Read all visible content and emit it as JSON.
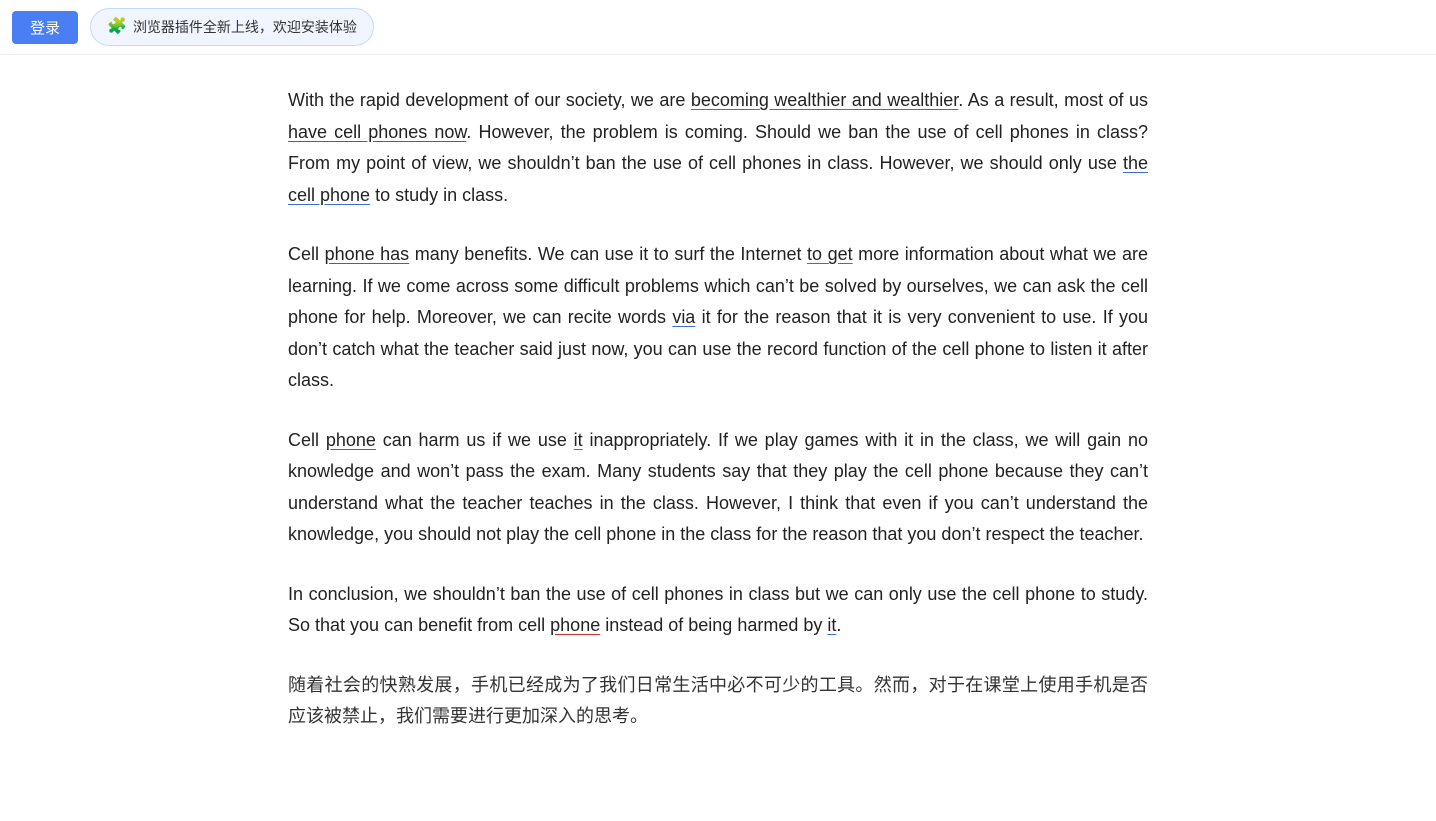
{
  "topbar": {
    "login_label": "登录",
    "plugin_text": "浏览器插件全新上线，欢迎安装体验"
  },
  "paragraphs": [
    {
      "id": "para1",
      "segments": [
        {
          "text": "With the rapid development of our society, we are ",
          "style": "normal"
        },
        {
          "text": "becoming wealthier and wealthier",
          "style": "underline-blue"
        },
        {
          "text": ". As a result, most of us ",
          "style": "normal"
        },
        {
          "text": "have cell phones now",
          "style": "underline-red"
        },
        {
          "text": ". However, the problem is coming. Should we ban the use of cell phones in class? From my point of view, we shouldn’t ban the use of cell phones in class. However, we should only use ",
          "style": "normal"
        },
        {
          "text": "the cell phone",
          "style": "underline-blue"
        },
        {
          "text": " to study in class.",
          "style": "normal"
        }
      ]
    },
    {
      "id": "para2",
      "segments": [
        {
          "text": "Cell ",
          "style": "normal"
        },
        {
          "text": "phone has",
          "style": "underline-red"
        },
        {
          "text": " many benefits. We can use it to surf the Internet ",
          "style": "normal"
        },
        {
          "text": "to get",
          "style": "underline-blue"
        },
        {
          "text": " more information about what we are learning. If we come across some difficult problems which can’t be solved by ourselves, we can ask the cell phone for help. Moreover, we can recite words ",
          "style": "normal"
        },
        {
          "text": "via",
          "style": "underline-blue"
        },
        {
          "text": " it for the reason that it is very convenient to use. If you don’t catch what the teacher said just now, you can use the record function of the cell phone to listen it after class.",
          "style": "normal"
        }
      ]
    },
    {
      "id": "para3",
      "segments": [
        {
          "text": "Cell ",
          "style": "normal"
        },
        {
          "text": "phone",
          "style": "underline-red"
        },
        {
          "text": " can harm us if we use ",
          "style": "normal"
        },
        {
          "text": "it",
          "style": "underline-blue"
        },
        {
          "text": " inappropriately. If we play games with it in the class, we will gain no knowledge and won’t pass the exam. Many students say that they play the cell phone because they can’t understand what the teacher teaches in the class. However, I think that even if you can’t understand the knowledge, you should not play the cell phone in the class for the reason that you don’t respect the teacher.",
          "style": "normal"
        }
      ]
    },
    {
      "id": "para4",
      "segments": [
        {
          "text": "In conclusion, we shouldn’t ban the use of cell phones in class but we can only use the cell phone to study. So that you can benefit from cell ",
          "style": "normal"
        },
        {
          "text": "phone",
          "style": "underline-red"
        },
        {
          "text": " instead of being harmed by ",
          "style": "normal"
        },
        {
          "text": "it",
          "style": "underline-blue"
        },
        {
          "text": ".",
          "style": "normal"
        }
      ]
    },
    {
      "id": "para5",
      "segments": [
        {
          "text": "随着社会的快熟发展，手机已经成为了我们日常生活中必不可少的工具。然而，对于在课堂上使用手机是否应该被禁止，我们需要进行更加深入的思考。",
          "style": "chinese-text"
        }
      ]
    }
  ]
}
